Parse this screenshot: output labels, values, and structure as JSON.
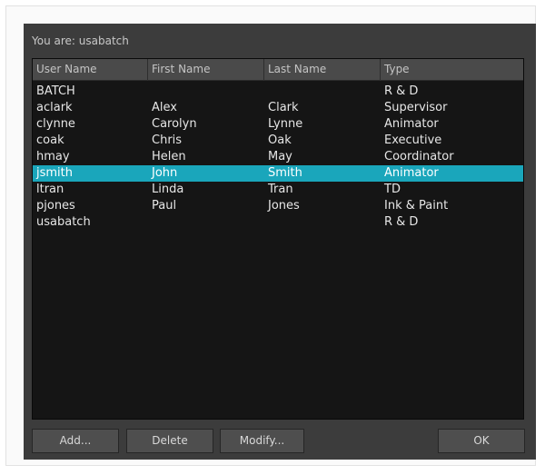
{
  "dialog": {
    "you_are_label": "You are: usabatch"
  },
  "table": {
    "columns": [
      "User Name",
      "First Name",
      "Last Name",
      "Type"
    ],
    "selected_index": 5,
    "rows": [
      [
        "BATCH",
        "",
        "",
        "R & D"
      ],
      [
        "aclark",
        "Alex",
        "Clark",
        "Supervisor"
      ],
      [
        "clynne",
        "Carolyn",
        "Lynne",
        "Animator"
      ],
      [
        "coak",
        "Chris",
        "Oak",
        "Executive"
      ],
      [
        "hmay",
        "Helen",
        "May",
        "Coordinator"
      ],
      [
        "jsmith",
        "John",
        "Smith",
        "Animator"
      ],
      [
        "ltran",
        "Linda",
        "Tran",
        "TD"
      ],
      [
        "pjones",
        "Paul",
        "Jones",
        "Ink & Paint"
      ],
      [
        "usabatch",
        "",
        "",
        "R & D"
      ]
    ]
  },
  "buttons": {
    "add": "Add...",
    "delete": "Delete",
    "modify": "Modify...",
    "ok": "OK"
  },
  "colors": {
    "dialog_bg": "#3c3c3c",
    "list_bg": "#151515",
    "selection": "#1aa6bb"
  }
}
